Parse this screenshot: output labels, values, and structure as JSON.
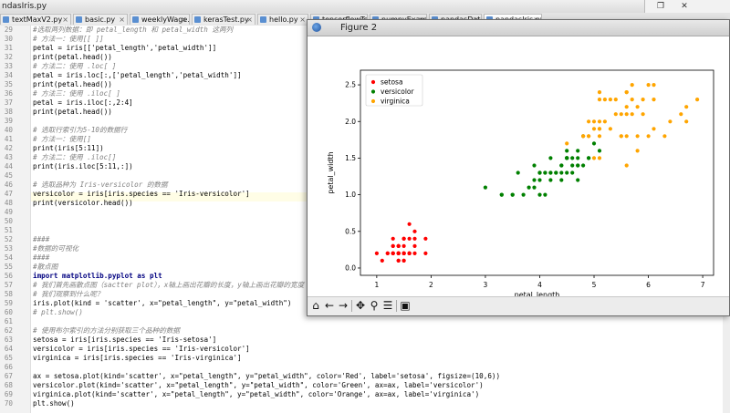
{
  "ide": {
    "filename": "ndasIris.py",
    "tabs": [
      "textMaxV2.py",
      "basic.py",
      "weeklyWage.py",
      "kerasTest.py",
      "hello.py",
      "tensorflowTest.py",
      "numpyExample.py",
      "pandasDataFrame.py",
      "pandasIris.py"
    ],
    "lines": [
      {
        "n": "29",
        "t": "#选取两列数据：即 petal_length 和 petal_width 这两列",
        "c": "comment"
      },
      {
        "n": "30",
        "t": "# 方法一：使用[[ ]]",
        "c": "comment"
      },
      {
        "n": "31",
        "t": "petal = iris[['petal_length','petal_width']]",
        "c": ""
      },
      {
        "n": "32",
        "t": "print(petal.head())",
        "c": ""
      },
      {
        "n": "33",
        "t": "# 方法二：使用 .loc[ ]",
        "c": "comment"
      },
      {
        "n": "34",
        "t": "petal = iris.loc[:,['petal_length','petal_width']]",
        "c": ""
      },
      {
        "n": "35",
        "t": "print(petal.head())",
        "c": ""
      },
      {
        "n": "36",
        "t": "# 方法三：使用 .iloc[ ]",
        "c": "comment"
      },
      {
        "n": "37",
        "t": "petal = iris.iloc[:,2:4]",
        "c": ""
      },
      {
        "n": "38",
        "t": "print(petal.head())",
        "c": ""
      },
      {
        "n": "39",
        "t": "",
        "c": ""
      },
      {
        "n": "40",
        "t": "# 选取行索引为5-10的数据行",
        "c": "comment"
      },
      {
        "n": "41",
        "t": "# 方法一：使用[]",
        "c": "comment"
      },
      {
        "n": "42",
        "t": "print(iris[5:11])",
        "c": ""
      },
      {
        "n": "43",
        "t": "# 方法二：使用 .iloc[]",
        "c": "comment"
      },
      {
        "n": "44",
        "t": "print(iris.iloc[5:11,:])",
        "c": ""
      },
      {
        "n": "45",
        "t": "",
        "c": ""
      },
      {
        "n": "46",
        "t": "# 选取品种为 Iris-versicolor 的数据",
        "c": "comment"
      },
      {
        "n": "47",
        "t": "versicolor = iris[iris.species == 'Iris-versicolor']",
        "c": ""
      },
      {
        "n": "48",
        "t": "print(versicolor.head())",
        "c": ""
      },
      {
        "n": "49",
        "t": "",
        "c": ""
      },
      {
        "n": "50",
        "t": "",
        "c": ""
      },
      {
        "n": "51",
        "t": "",
        "c": ""
      },
      {
        "n": "52",
        "t": "####",
        "c": "comment"
      },
      {
        "n": "53",
        "t": "#数据的可视化",
        "c": "comment"
      },
      {
        "n": "54",
        "t": "####",
        "c": "comment"
      },
      {
        "n": "55",
        "t": "#散点图",
        "c": "comment"
      },
      {
        "n": "56",
        "t": "import matplotlib.pyplot as plt",
        "c": "kw"
      },
      {
        "n": "57",
        "t": "# 我们首先画散点图（sactter plot），x轴上画出花瓣的长度，y轴上画出花瓣的宽度",
        "c": "comment"
      },
      {
        "n": "58",
        "t": "# 我们观察到什么呢？",
        "c": "comment"
      },
      {
        "n": "59",
        "t": "iris.plot(kind = 'scatter', x=\"petal_length\", y=\"petal_width\")",
        "c": ""
      },
      {
        "n": "60",
        "t": "# plt.show()",
        "c": "comment"
      },
      {
        "n": "61",
        "t": "",
        "c": ""
      },
      {
        "n": "62",
        "t": "# 使用布尔索引的方法分别获取三个品种的数据",
        "c": "comment"
      },
      {
        "n": "63",
        "t": "setosa = iris[iris.species == 'Iris-setosa']",
        "c": ""
      },
      {
        "n": "64",
        "t": "versicolor = iris[iris.species == 'Iris-versicolor']",
        "c": ""
      },
      {
        "n": "65",
        "t": "virginica = iris[iris.species == 'Iris-virginica']",
        "c": ""
      },
      {
        "n": "66",
        "t": "",
        "c": ""
      },
      {
        "n": "67",
        "t": "ax = setosa.plot(kind='scatter', x=\"petal_length\", y=\"petal_width\", color='Red', label='setosa', figsize=(10,6))",
        "c": ""
      },
      {
        "n": "68",
        "t": "versicolor.plot(kind='scatter', x=\"petal_length\", y=\"petal_width\", color='Green', ax=ax, label='versicolor')",
        "c": ""
      },
      {
        "n": "69",
        "t": "virginica.plot(kind='scatter', x=\"petal_length\", y=\"petal_width\", color='Orange', ax=ax, label='virginica')",
        "c": ""
      },
      {
        "n": "70",
        "t": "plt.show()",
        "c": ""
      }
    ]
  },
  "figure": {
    "title": "Figure 2",
    "toolbar_icons": [
      "home-icon",
      "back-arrow-icon",
      "forward-arrow-icon",
      "pan-icon",
      "zoom-icon",
      "configure-subplots-icon",
      "save-icon"
    ]
  },
  "chart_data": {
    "type": "scatter",
    "title": "",
    "xlabel": "petal_length",
    "ylabel": "petal_width",
    "xlim": [
      0.7,
      7.2
    ],
    "ylim": [
      -0.1,
      2.7
    ],
    "xticks": [
      1,
      2,
      3,
      4,
      5,
      6,
      7
    ],
    "yticks": [
      0.0,
      0.5,
      1.0,
      1.5,
      2.0,
      2.5
    ],
    "ytick_labels": [
      "0.0",
      "0.5",
      "1.0",
      "1.5",
      "2.0",
      "2.5"
    ],
    "grid": false,
    "legend": "top-left",
    "series": [
      {
        "name": "setosa",
        "color": "#ff0000",
        "points": [
          [
            1.4,
            0.2
          ],
          [
            1.4,
            0.2
          ],
          [
            1.3,
            0.2
          ],
          [
            1.5,
            0.2
          ],
          [
            1.4,
            0.2
          ],
          [
            1.7,
            0.4
          ],
          [
            1.4,
            0.3
          ],
          [
            1.5,
            0.2
          ],
          [
            1.4,
            0.2
          ],
          [
            1.5,
            0.1
          ],
          [
            1.5,
            0.2
          ],
          [
            1.6,
            0.2
          ],
          [
            1.4,
            0.1
          ],
          [
            1.1,
            0.1
          ],
          [
            1.2,
            0.2
          ],
          [
            1.5,
            0.4
          ],
          [
            1.3,
            0.4
          ],
          [
            1.4,
            0.3
          ],
          [
            1.7,
            0.3
          ],
          [
            1.5,
            0.3
          ],
          [
            1.7,
            0.2
          ],
          [
            1.5,
            0.4
          ],
          [
            1.0,
            0.2
          ],
          [
            1.7,
            0.5
          ],
          [
            1.9,
            0.2
          ],
          [
            1.6,
            0.2
          ],
          [
            1.6,
            0.4
          ],
          [
            1.5,
            0.2
          ],
          [
            1.4,
            0.2
          ],
          [
            1.6,
            0.2
          ],
          [
            1.6,
            0.2
          ],
          [
            1.5,
            0.4
          ],
          [
            1.5,
            0.1
          ],
          [
            1.4,
            0.2
          ],
          [
            1.5,
            0.2
          ],
          [
            1.2,
            0.2
          ],
          [
            1.3,
            0.2
          ],
          [
            1.4,
            0.1
          ],
          [
            1.3,
            0.2
          ],
          [
            1.5,
            0.2
          ],
          [
            1.3,
            0.3
          ],
          [
            1.3,
            0.3
          ],
          [
            1.3,
            0.2
          ],
          [
            1.6,
            0.6
          ],
          [
            1.9,
            0.4
          ],
          [
            1.4,
            0.3
          ],
          [
            1.6,
            0.2
          ],
          [
            1.4,
            0.2
          ],
          [
            1.5,
            0.2
          ],
          [
            1.4,
            0.2
          ]
        ]
      },
      {
        "name": "versicolor",
        "color": "#008000",
        "points": [
          [
            4.7,
            1.4
          ],
          [
            4.5,
            1.5
          ],
          [
            4.9,
            1.5
          ],
          [
            4.0,
            1.3
          ],
          [
            4.6,
            1.5
          ],
          [
            4.5,
            1.3
          ],
          [
            4.7,
            1.6
          ],
          [
            3.3,
            1.0
          ],
          [
            4.6,
            1.3
          ],
          [
            3.9,
            1.4
          ],
          [
            3.5,
            1.0
          ],
          [
            4.2,
            1.5
          ],
          [
            4.0,
            1.0
          ],
          [
            4.7,
            1.4
          ],
          [
            3.6,
            1.3
          ],
          [
            4.4,
            1.4
          ],
          [
            4.5,
            1.5
          ],
          [
            4.1,
            1.0
          ],
          [
            4.5,
            1.5
          ],
          [
            3.9,
            1.1
          ],
          [
            4.8,
            1.8
          ],
          [
            4.0,
            1.3
          ],
          [
            4.9,
            1.5
          ],
          [
            4.7,
            1.2
          ],
          [
            4.3,
            1.3
          ],
          [
            4.4,
            1.4
          ],
          [
            4.8,
            1.4
          ],
          [
            5.0,
            1.7
          ],
          [
            4.5,
            1.5
          ],
          [
            3.5,
            1.0
          ],
          [
            3.8,
            1.1
          ],
          [
            3.7,
            1.0
          ],
          [
            3.9,
            1.2
          ],
          [
            5.1,
            1.6
          ],
          [
            4.5,
            1.5
          ],
          [
            4.5,
            1.6
          ],
          [
            4.7,
            1.5
          ],
          [
            4.4,
            1.3
          ],
          [
            4.1,
            1.3
          ],
          [
            4.0,
            1.3
          ],
          [
            4.4,
            1.2
          ],
          [
            4.6,
            1.4
          ],
          [
            4.0,
            1.2
          ],
          [
            3.3,
            1.0
          ],
          [
            4.2,
            1.3
          ],
          [
            4.2,
            1.2
          ],
          [
            4.2,
            1.3
          ],
          [
            4.3,
            1.3
          ],
          [
            3.0,
            1.1
          ],
          [
            4.1,
            1.3
          ]
        ]
      },
      {
        "name": "virginica",
        "color": "#ffa500",
        "points": [
          [
            6.0,
            2.5
          ],
          [
            5.1,
            1.9
          ],
          [
            5.9,
            2.1
          ],
          [
            5.6,
            1.8
          ],
          [
            5.8,
            2.2
          ],
          [
            6.6,
            2.1
          ],
          [
            4.5,
            1.7
          ],
          [
            6.3,
            1.8
          ],
          [
            5.8,
            1.8
          ],
          [
            6.1,
            2.5
          ],
          [
            5.1,
            2.0
          ],
          [
            5.3,
            1.9
          ],
          [
            5.5,
            2.1
          ],
          [
            5.0,
            2.0
          ],
          [
            5.1,
            2.4
          ],
          [
            5.3,
            2.3
          ],
          [
            5.5,
            1.8
          ],
          [
            6.7,
            2.2
          ],
          [
            6.9,
            2.3
          ],
          [
            5.0,
            1.5
          ],
          [
            5.7,
            2.3
          ],
          [
            4.9,
            2.0
          ],
          [
            6.7,
            2.0
          ],
          [
            4.9,
            1.8
          ],
          [
            5.7,
            2.1
          ],
          [
            6.0,
            1.8
          ],
          [
            4.8,
            1.8
          ],
          [
            4.9,
            1.8
          ],
          [
            5.6,
            2.1
          ],
          [
            5.8,
            1.6
          ],
          [
            6.1,
            1.9
          ],
          [
            6.4,
            2.0
          ],
          [
            5.6,
            2.2
          ],
          [
            5.1,
            1.5
          ],
          [
            5.6,
            1.4
          ],
          [
            6.1,
            2.3
          ],
          [
            5.6,
            2.4
          ],
          [
            5.5,
            1.8
          ],
          [
            4.8,
            1.8
          ],
          [
            5.4,
            2.1
          ],
          [
            5.6,
            2.4
          ],
          [
            5.1,
            2.3
          ],
          [
            5.1,
            1.9
          ],
          [
            5.9,
            2.3
          ],
          [
            5.7,
            2.5
          ],
          [
            5.2,
            2.3
          ],
          [
            5.0,
            1.9
          ],
          [
            5.2,
            2.0
          ],
          [
            5.4,
            2.3
          ],
          [
            5.1,
            1.8
          ]
        ]
      }
    ]
  }
}
